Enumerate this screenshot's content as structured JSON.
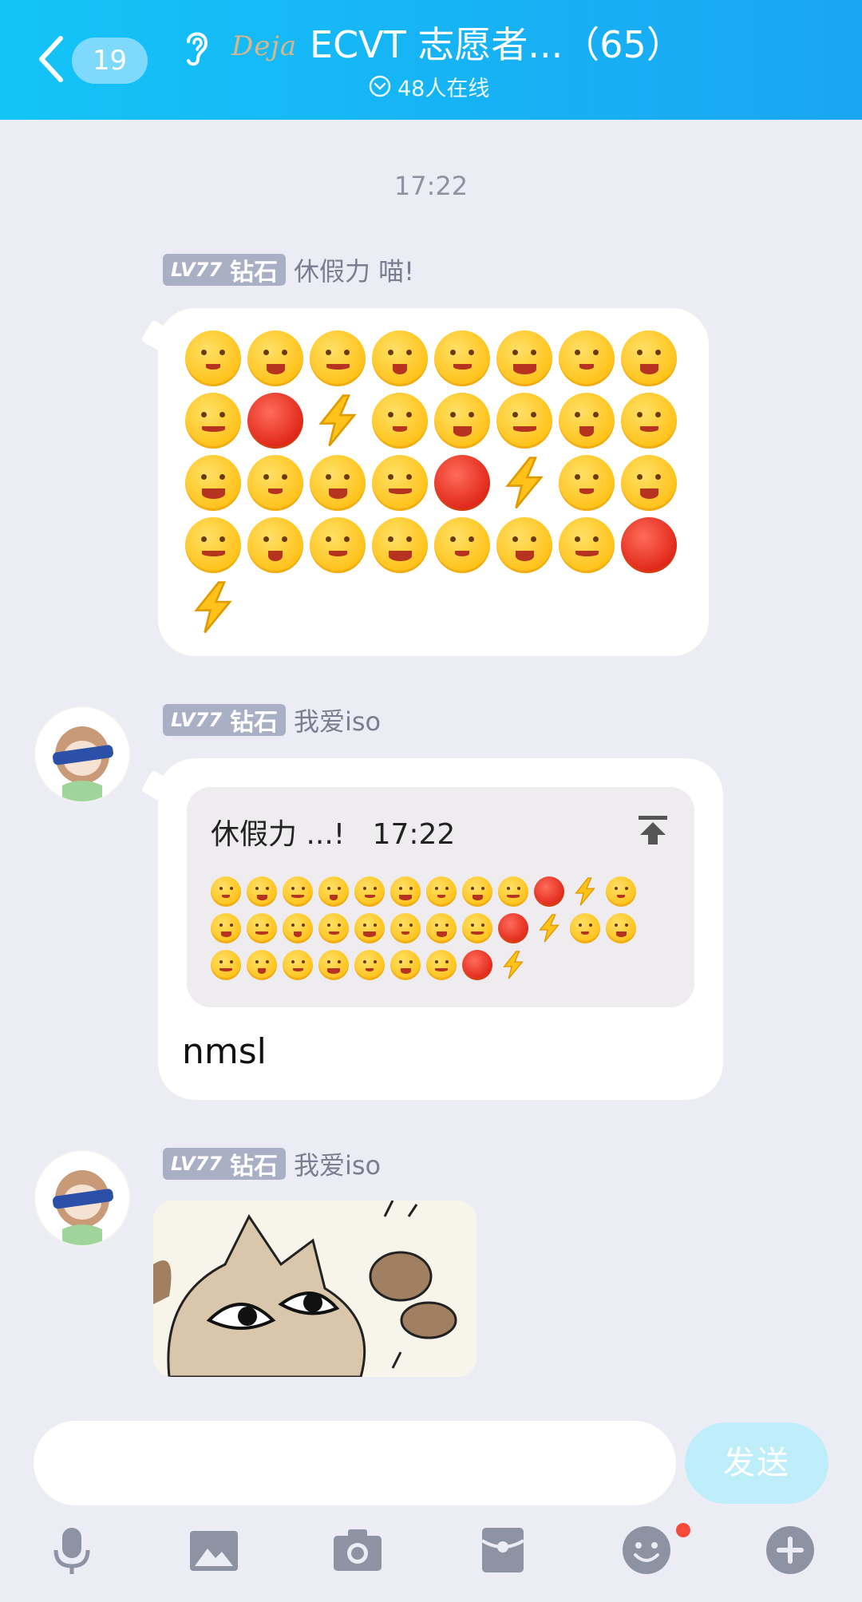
{
  "header": {
    "back_count": "19",
    "logo_text": "Deja",
    "title": "ECVT 志愿者...（65）",
    "online": "48人在线"
  },
  "chat": {
    "time_separator": "17:22",
    "messages": [
      {
        "level": "LV77",
        "rank": "钻石",
        "sender": "休假力 喵!",
        "type": "emoji",
        "emoji_count": 33
      },
      {
        "level": "LV77",
        "rank": "钻石",
        "sender": "我爱iso",
        "type": "reply",
        "quote_header": "休假力 ...!",
        "quote_time": "17:22",
        "text": "nmsl"
      },
      {
        "level": "LV77",
        "rank": "钻石",
        "sender": "我爱iso",
        "type": "sticker",
        "sticker_desc": "cat-sticker"
      }
    ]
  },
  "input": {
    "placeholder": "",
    "send_label": "发送"
  },
  "toolbar": [
    "microphone-icon",
    "image-icon",
    "camera-icon",
    "red-packet-icon",
    "emoji-icon",
    "plus-icon"
  ],
  "colors": {
    "header": "#16b4f5",
    "background": "#ececf5",
    "send_button": "#bfeefb",
    "badge": "#a9afc4"
  }
}
